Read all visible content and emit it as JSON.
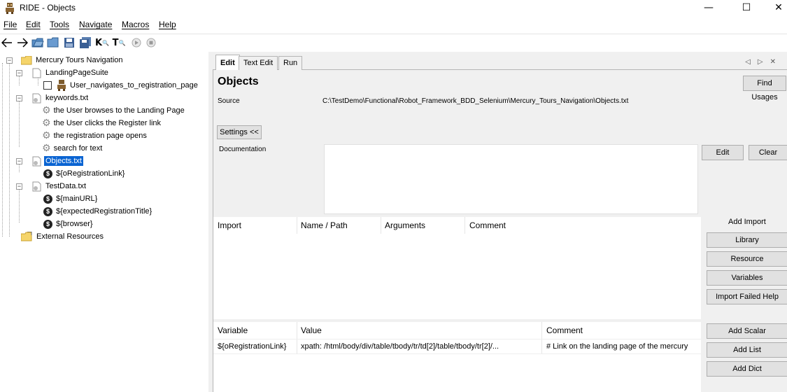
{
  "window": {
    "title": "RIDE - Objects"
  },
  "menu": [
    "File",
    "Edit",
    "Tools",
    "Navigate",
    "Macros",
    "Help"
  ],
  "tree": {
    "root": "Mercury Tours Navigation",
    "suite": "LandingPageSuite",
    "test": "User_navigates_to_registration_page",
    "keywords_file": "keywords.txt",
    "keywords": [
      "the User browses to the Landing Page",
      "the User clicks the Register link",
      "the registration page opens",
      "search for text"
    ],
    "objects_file": "Objects.txt",
    "objects_vars": [
      "${oRegistrationLink}"
    ],
    "testdata_file": "TestData.txt",
    "testdata_vars": [
      "${mainURL}",
      "${expectedRegistrationTitle}",
      "${browser}"
    ],
    "external": "External Resources"
  },
  "tabs": [
    "Edit",
    "Text Edit",
    "Run"
  ],
  "editor": {
    "title": "Objects",
    "find_usages": "Find Usages",
    "source_label": "Source",
    "source_path": "C:\\TestDemo\\Functional\\Robot_Framework_BDD_Selenium\\Mercury_Tours_Navigation\\Objects.txt",
    "settings_button": "Settings <<",
    "documentation_label": "Documentation",
    "edit_button": "Edit",
    "clear_button": "Clear",
    "imports": {
      "headers": [
        "Import",
        "Name / Path",
        "Arguments",
        "Comment"
      ],
      "add_import_label": "Add Import",
      "buttons": [
        "Library",
        "Resource",
        "Variables",
        "Import Failed Help"
      ]
    },
    "variables": {
      "headers": [
        "Variable",
        "Value",
        "Comment"
      ],
      "rows": [
        {
          "name": "${oRegistrationLink}",
          "value": "xpath: /html/body/div/table/tbody/tr/td[2]/table/tbody/tr[2]/...",
          "comment": "# Link on the landing page of the mercury"
        }
      ],
      "buttons": [
        "Add Scalar",
        "Add List",
        "Add Dict"
      ]
    }
  },
  "colors": {
    "selection": "#0a64d2",
    "panel": "#f0f0f0",
    "button": "#e1e1e1"
  }
}
